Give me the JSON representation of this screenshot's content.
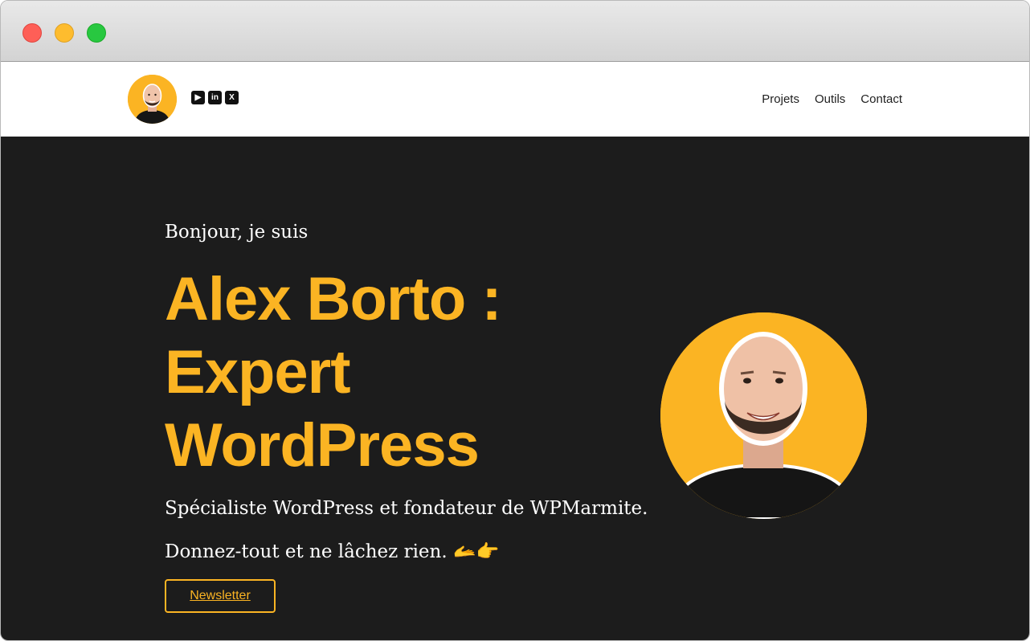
{
  "browser": {
    "controls": [
      "close",
      "minimize",
      "zoom"
    ]
  },
  "header": {
    "avatar_icon": "profile-photo",
    "socials": [
      {
        "name": "youtube-icon",
        "glyph": "▶"
      },
      {
        "name": "linkedin-icon",
        "glyph": "in"
      },
      {
        "name": "x-icon",
        "glyph": "X"
      }
    ],
    "nav": [
      "Projets",
      "Outils",
      "Contact"
    ]
  },
  "hero": {
    "greeting": "Bonjour, je suis",
    "headline_line1": "Alex Borto :",
    "headline_line2": "Expert",
    "headline_line3": "WordPress",
    "tagline": "Spécialiste WordPress et fondateur de WPMarmite.",
    "motto": "Donnez-tout et ne lâchez rien.",
    "motto_emoji": "🫴👉",
    "button_label": "Newsletter",
    "portrait_icon": "portrait-photo"
  },
  "colors": {
    "accent": "#fbb423",
    "hero_background": "#1c1c1c"
  }
}
